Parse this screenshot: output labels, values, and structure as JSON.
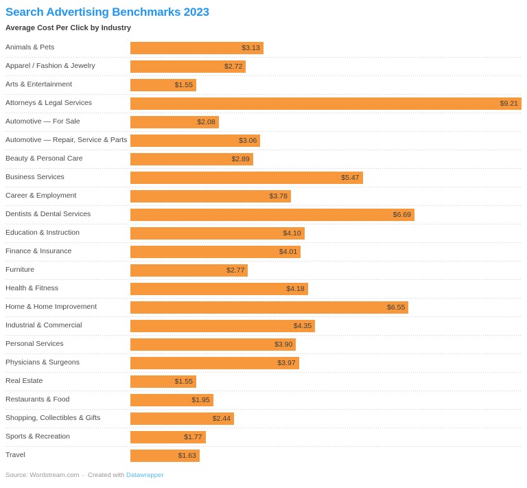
{
  "header": {
    "title": "Search Advertising Benchmarks 2023",
    "subtitle": "Average Cost Per Click by Industry"
  },
  "footer": {
    "source_label": "Source: Wordstream.com",
    "separator": "·",
    "created_with": "Created with",
    "tool": "Datawrapper"
  },
  "colors": {
    "title": "#2196f3",
    "bar": "#f8983c",
    "label": "#4a4a4a",
    "value": "#3d3d3d",
    "gridline": "#cfcfcf",
    "footer": "#9a9a9a",
    "link": "#57bdf5"
  },
  "chart_data": {
    "type": "bar",
    "orientation": "horizontal",
    "title": "Search Advertising Benchmarks 2023",
    "subtitle": "Average Cost Per Click by Industry",
    "xlabel": "",
    "ylabel": "",
    "xlim": [
      0,
      9.21
    ],
    "grid": false,
    "value_prefix": "$",
    "value_labels_inside": true,
    "legend": null,
    "source": "Wordstream.com",
    "categories": [
      "Animals & Pets",
      "Apparel / Fashion & Jewelry",
      "Arts & Entertainment",
      "Attorneys & Legal Services",
      "Automotive — For Sale",
      "Automotive — Repair, Service & Parts",
      "Beauty & Personal Care",
      "Business Services",
      "Career & Employment",
      "Dentists & Dental Services",
      "Education & Instruction",
      "Finance & Insurance",
      "Furniture",
      "Health & Fitness",
      "Home & Home Improvement",
      "Industrial & Commercial",
      "Personal Services",
      "Physicians & Surgeons",
      "Real Estate",
      "Restaurants & Food",
      "Shopping, Collectibles & Gifts",
      "Sports & Recreation",
      "Travel"
    ],
    "values": [
      3.13,
      2.72,
      1.55,
      9.21,
      2.08,
      3.06,
      2.89,
      5.47,
      3.78,
      6.69,
      4.1,
      4.01,
      2.77,
      4.18,
      6.55,
      4.35,
      3.9,
      3.97,
      1.55,
      1.95,
      2.44,
      1.77,
      1.63
    ],
    "value_labels": [
      "$3.13",
      "$2.72",
      "$1.55",
      "$9.21",
      "$2.08",
      "$3.06",
      "$2.89",
      "$5.47",
      "$3.78",
      "$6.69",
      "$4.10",
      "$4.01",
      "$2.77",
      "$4.18",
      "$6.55",
      "$4.35",
      "$3.90",
      "$3.97",
      "$1.55",
      "$1.95",
      "$2.44",
      "$1.77",
      "$1.63"
    ]
  }
}
